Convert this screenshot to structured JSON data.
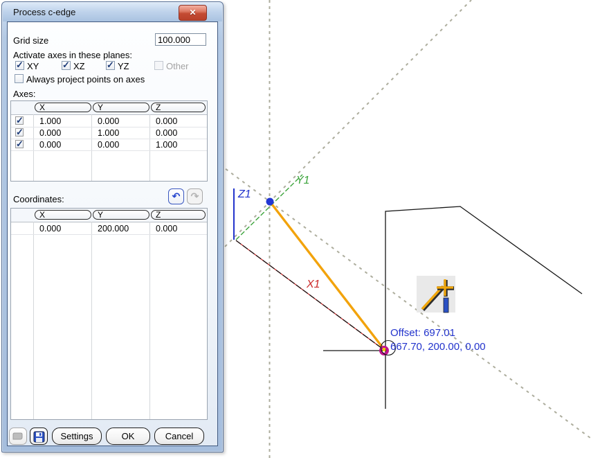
{
  "window": {
    "title": "Process c-edge",
    "close_glyph": "✕"
  },
  "dialog": {
    "grid_size": {
      "label": "Grid size",
      "value": "100.000"
    },
    "activate_label": "Activate axes in these planes:",
    "plane_checkboxes": [
      {
        "label": "XY",
        "checked": true,
        "enabled": true
      },
      {
        "label": "XZ",
        "checked": true,
        "enabled": true
      },
      {
        "label": "YZ",
        "checked": true,
        "enabled": true
      },
      {
        "label": "Other",
        "checked": false,
        "enabled": false
      }
    ],
    "always_project": {
      "label": "Always project points on axes",
      "checked": false
    },
    "axes_section_label": "Axes:",
    "axes_table": {
      "columns": [
        "X",
        "Y",
        "Z"
      ],
      "rows": [
        {
          "checked": true,
          "values": [
            "1.000",
            "0.000",
            "0.000"
          ]
        },
        {
          "checked": true,
          "values": [
            "0.000",
            "1.000",
            "0.000"
          ]
        },
        {
          "checked": true,
          "values": [
            "0.000",
            "0.000",
            "1.000"
          ]
        }
      ]
    },
    "coordinates_section_label": "Coordinates:",
    "undo_glyph": "↶",
    "redo_glyph": "↷",
    "coordinates_table": {
      "columns": [
        "X",
        "Y",
        "Z"
      ],
      "rows": [
        {
          "values": [
            "0.000",
            "200.000",
            "0.000"
          ]
        }
      ]
    },
    "buttons": {
      "settings": "Settings",
      "ok": "OK",
      "cancel": "Cancel"
    }
  },
  "canvas": {
    "axis_labels": {
      "x": "X1",
      "y": "Y1",
      "z": "Z1"
    },
    "offset_line1": "Offset: 697.01",
    "offset_line2": "667.70, 200.00, 0.00",
    "colors": {
      "rubber_band_orange": "#F2A30C",
      "start_point_blue": "#2236D4",
      "snap_point_magenta": "#C0148C",
      "snap_point_center_yellow": "#F6C60A",
      "construction_dash_gray": "#ADAD9D",
      "axis_x_red": "#CC2A2A",
      "axis_y_green": "#3CA43C",
      "axis_z_blue": "#2233CC",
      "offset_text_blue": "#2233CC"
    }
  }
}
